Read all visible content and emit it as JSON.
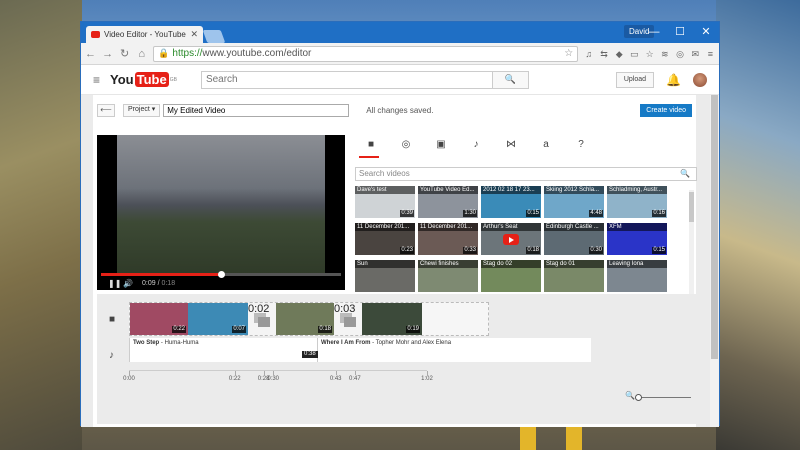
{
  "browser": {
    "tab_title": "Video Editor - YouTube",
    "tab_close": "✕",
    "user_name": "David",
    "url_scheme": "https://",
    "url_rest": "www.youtube.com/editor",
    "win_min": "—",
    "win_max": "☐",
    "win_close": "✕"
  },
  "youtube": {
    "logo_you": "You",
    "logo_tube": "Tube",
    "logo_region": "GB",
    "search_placeholder": "Search",
    "upload_label": "Upload"
  },
  "editor": {
    "project_label": "Project",
    "title_value": "My Edited Video",
    "save_status": "All changes saved.",
    "create_label": "Create video",
    "player": {
      "current_time": "0:09",
      "duration": "0:18",
      "progress_fraction": 0.5
    },
    "library_search_placeholder": "Search videos",
    "tabs": [
      {
        "name": "videos-tab-icon",
        "glyph": "■"
      },
      {
        "name": "creative-commons-tab-icon",
        "glyph": "◎"
      },
      {
        "name": "photos-tab-icon",
        "glyph": "▣"
      },
      {
        "name": "audio-tab-icon",
        "glyph": "♪"
      },
      {
        "name": "transitions-tab-icon",
        "glyph": "⋈"
      },
      {
        "name": "text-tab-icon",
        "glyph": "a"
      },
      {
        "name": "help-tab-icon",
        "glyph": "?"
      }
    ],
    "library": [
      {
        "title": "Dave's test",
        "duration": "0:39",
        "color": "#cfd3d6"
      },
      {
        "title": "YouTube Video Ed...",
        "duration": "1:30",
        "color": "#8d939c"
      },
      {
        "title": "2012 02 18 17 23...",
        "duration": "0:15",
        "color": "#3a8bb8"
      },
      {
        "title": "Skiing 2012 Schla...",
        "duration": "4:48",
        "color": "#6fa7c9"
      },
      {
        "title": "Schladming, Austr...",
        "duration": "0:16",
        "color": "#8fb3c9"
      },
      {
        "title": "11 December 201...",
        "duration": "0:23",
        "color": "#4a4440"
      },
      {
        "title": "11 December 201...",
        "duration": "0:33",
        "color": "#6b5a55"
      },
      {
        "title": "Arthur's Seat",
        "duration": "0:18",
        "color": "#6c757a"
      },
      {
        "title": "Edinburgh Castle ...",
        "duration": "0:30",
        "color": "#5d6a73"
      },
      {
        "title": "XFM",
        "duration": "0:15",
        "color": "#2a34c8"
      },
      {
        "title": "Sun",
        "duration": "",
        "color": "#6a6a66"
      },
      {
        "title": "Chewi finishes",
        "duration": "",
        "color": "#7e8a72"
      },
      {
        "title": "Stag do 02",
        "duration": "",
        "color": "#738a5c"
      },
      {
        "title": "Stag do 01",
        "duration": "",
        "color": "#7a8968"
      },
      {
        "title": "Leaving Iona",
        "duration": "",
        "color": "#7d8790"
      }
    ],
    "video_clips": [
      {
        "duration": "0:22",
        "color": "#a04a63"
      },
      {
        "duration": "0:07",
        "color": "#3d8ab5"
      },
      {
        "duration": "0:02",
        "color": "#e9e9e9"
      },
      {
        "duration": "0:18",
        "color": "#6f7a5a"
      },
      {
        "duration": "0:03",
        "color": "#eaeaea"
      },
      {
        "duration": "0:19",
        "color": "#3c4a3a"
      }
    ],
    "audio": [
      {
        "title": "Two Step",
        "artist": " - Huma-Huma"
      },
      {
        "title": "Where I Am From",
        "artist": " - Topher Mohr and Alex Elena"
      }
    ],
    "audio_badge": "0:38",
    "ruler": [
      {
        "label": "0:00",
        "seconds": 0
      },
      {
        "label": "0:22",
        "seconds": 22
      },
      {
        "label": "0:28",
        "seconds": 28
      },
      {
        "label": "0:30",
        "seconds": 30
      },
      {
        "label": "0:43",
        "seconds": 43
      },
      {
        "label": "0:47",
        "seconds": 47
      },
      {
        "label": "1:02",
        "seconds": 62
      }
    ]
  }
}
